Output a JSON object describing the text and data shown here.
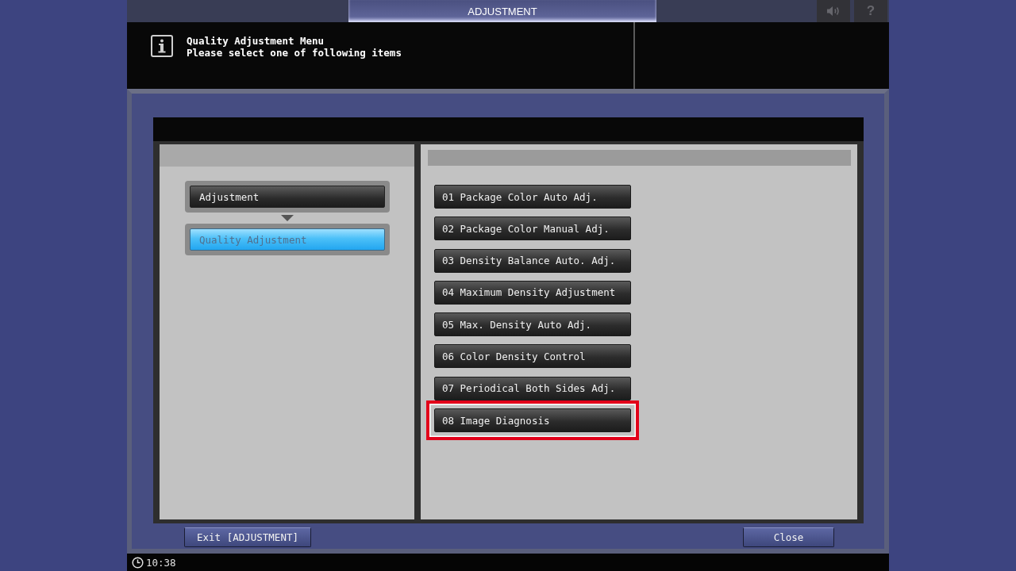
{
  "top_bar": {
    "title": "ADJUSTMENT",
    "help": "?"
  },
  "message": {
    "title": "Quality Adjustment Menu",
    "text": "Please select one of following items"
  },
  "breadcrumb": [
    {
      "label": "Adjustment",
      "selected": false
    },
    {
      "label": "Quality Adjustment",
      "selected": true
    }
  ],
  "menu_items": [
    {
      "label": "01 Package Color Auto Adj.",
      "highlighted": false
    },
    {
      "label": "02 Package Color Manual Adj.",
      "highlighted": false
    },
    {
      "label": "03 Density Balance Auto. Adj.",
      "highlighted": false
    },
    {
      "label": "04 Maximum Density Adjustment",
      "highlighted": false
    },
    {
      "label": "05 Max. Density Auto Adj.",
      "highlighted": false
    },
    {
      "label": "06 Color Density Control",
      "highlighted": false
    },
    {
      "label": "07 Periodical Both Sides Adj.",
      "highlighted": false
    },
    {
      "label": "08 Image Diagnosis",
      "highlighted": true
    }
  ],
  "footer_buttons": [
    {
      "label": "Exit [ADJUSTMENT]",
      "kind": "exit"
    },
    {
      "label": "Close",
      "kind": "close"
    }
  ],
  "status_bar": {
    "time": "10:38"
  }
}
